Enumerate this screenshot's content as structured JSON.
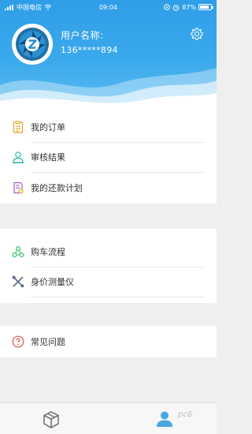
{
  "status_bar": {
    "carrier": "中国电信",
    "time": "09:04",
    "battery": "87%",
    "battery_level": 0.87
  },
  "profile": {
    "name_label": "用户名称:",
    "phone": "136*****894"
  },
  "menu_group_1": [
    {
      "label": "我的订单",
      "icon": "clipboard-icon"
    },
    {
      "label": "审核结果",
      "icon": "person-icon"
    },
    {
      "label": "我的还款计划",
      "icon": "plan-document-icon"
    }
  ],
  "menu_group_2": [
    {
      "label": "购车流程",
      "icon": "flow-icon"
    },
    {
      "label": "身价测量仪",
      "icon": "tools-icon"
    }
  ],
  "menu_group_3": [
    {
      "label": "常见问题",
      "icon": "question-icon"
    }
  ],
  "bottom_nav": {
    "items": [
      "cube-icon",
      "profile-icon"
    ],
    "active": "profile-icon"
  },
  "watermark": "pc6",
  "colors": {
    "header": "#38a6ea",
    "accent": "#4aa8e0",
    "background": "#efefef"
  }
}
